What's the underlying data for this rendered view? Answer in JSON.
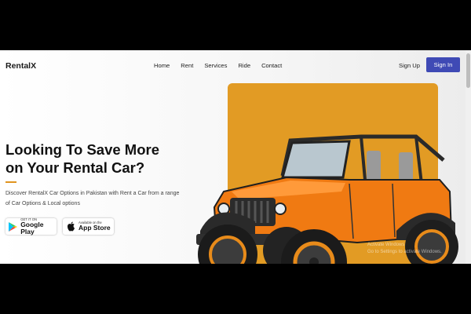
{
  "header": {
    "logo": "RentalX",
    "nav": [
      "Home",
      "Rent",
      "Services",
      "Ride",
      "Contact"
    ],
    "sign_up": "Sign Up",
    "sign_in": "Sign In"
  },
  "hero": {
    "title_line1": "Looking To Save More",
    "title_line2": "on Your Rental Car?",
    "description": "Discover RentalX Car Options in Pakistan with Rent a Car from a range of Car Options & Local options"
  },
  "stores": {
    "google": {
      "small": "GET IT ON",
      "big": "Google Play"
    },
    "apple": {
      "small": "Available on the",
      "big": "App Store"
    }
  },
  "watermark": {
    "line1": "Activate Windows",
    "line2": "Go to Settings to activate Windows."
  },
  "colors": {
    "accent": "#3f4ab5",
    "orange": "#e29b24",
    "underline": "#e0941f"
  }
}
